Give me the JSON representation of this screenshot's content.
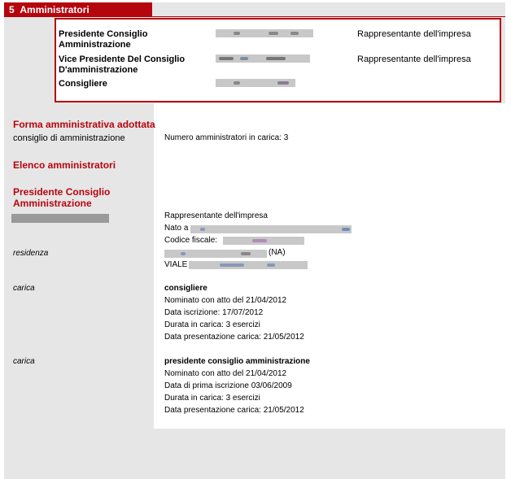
{
  "section": {
    "number": "5",
    "title": "Amministratori"
  },
  "summary_rows": [
    {
      "role": "Presidente Consiglio Amministrazione",
      "representative": "Rappresentante dell'impresa"
    },
    {
      "role": "Vice Presidente Del Consiglio D'amministrazione",
      "representative": "Rappresentante dell'impresa"
    },
    {
      "role": "Consigliere",
      "representative": ""
    }
  ],
  "forma": {
    "heading": "Forma amministrativa adottata",
    "value": "consiglio di amministrazione",
    "count_text": "Numero amministratori in carica: 3"
  },
  "elenco_heading": "Elenco amministratori",
  "person": {
    "heading": "Presidente Consiglio Amministrazione",
    "rep_label": "Rappresentante dell'impresa",
    "born_label": "Nato a",
    "cf_label": "Codice fiscale:",
    "residence_label": "residenza",
    "province": "(NA)",
    "street_prefix": "VIALE"
  },
  "cariche": [
    {
      "label": "carica",
      "title": "consigliere",
      "lines": [
        "Nominato con atto del 21/04/2012",
        "Data iscrizione: 17/07/2012",
        "Durata in carica: 3 esercizi",
        "Data presentazione carica: 21/05/2012"
      ]
    },
    {
      "label": "carica",
      "title": "presidente consiglio amministrazione",
      "lines": [
        "Nominato con atto del 21/04/2012",
        "Data di prima iscrizione 03/06/2009",
        "Durata in carica: 3 esercizi",
        "Data presentazione carica: 21/05/2012"
      ]
    }
  ],
  "colors": {
    "accent": "#b5050d",
    "panel": "#e6e6e6",
    "redaction": "#c8c8c8"
  }
}
